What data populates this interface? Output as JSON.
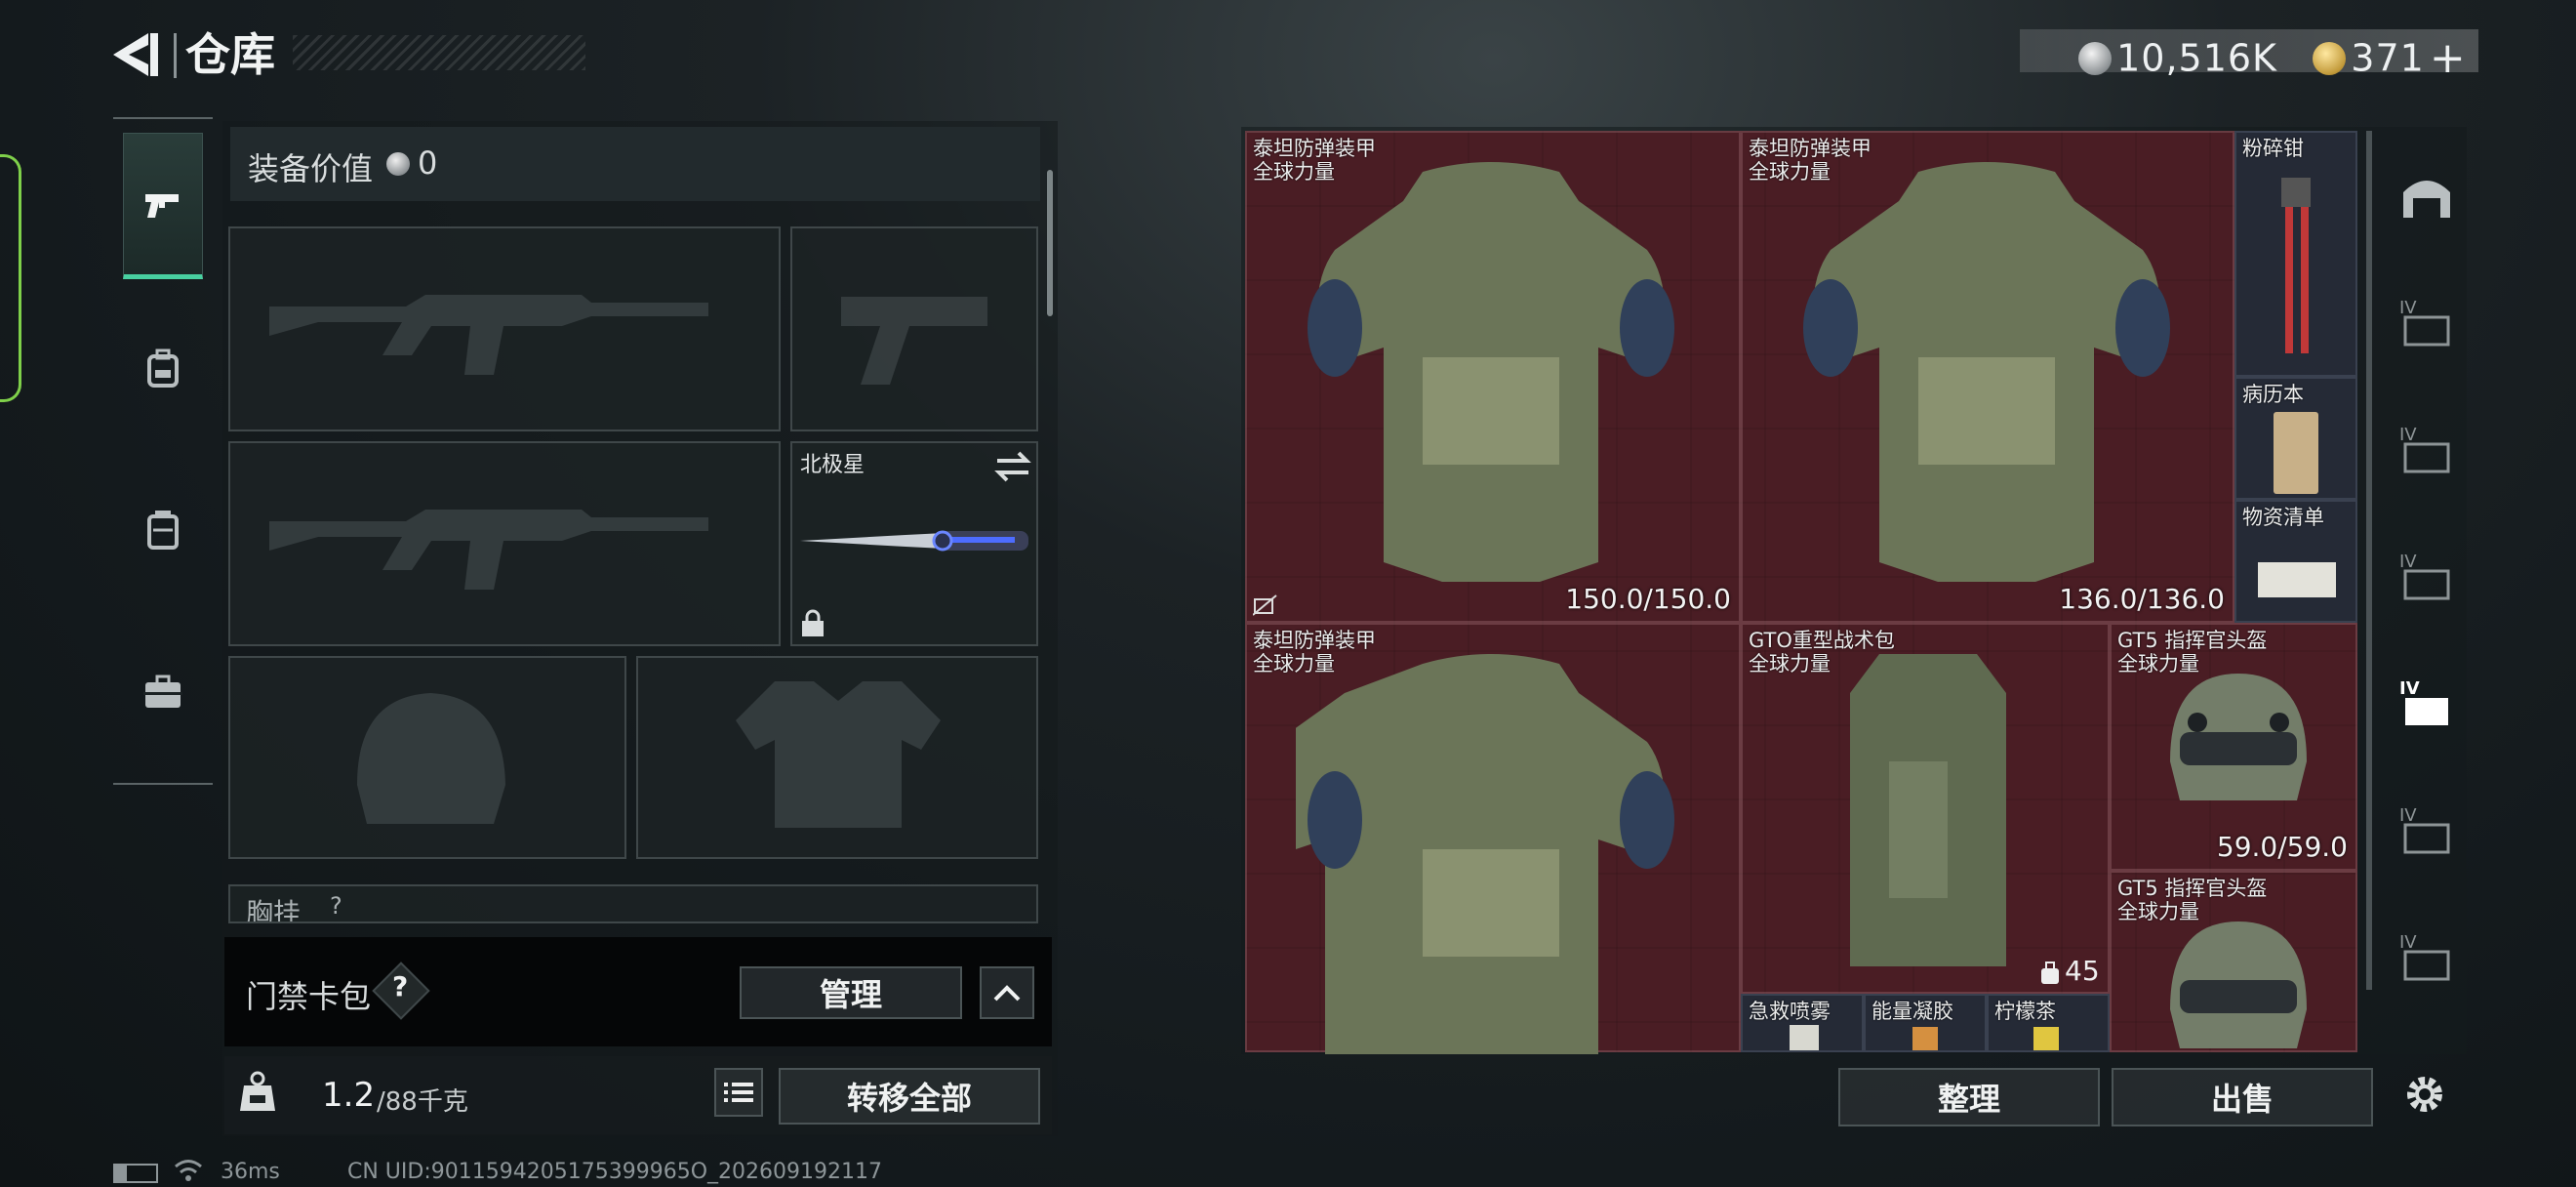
{
  "header": {
    "title": "仓库",
    "silver_amount": "10,516K",
    "gold_amount": "371",
    "gold_plus": "+"
  },
  "left": {
    "value_label": "装备价值",
    "value_amount": "0",
    "pistol_slot_label": "北极星",
    "partial_label": "胸挂",
    "partial_help": "?",
    "access_label": "门禁卡包",
    "access_help": "?",
    "manage_button": "管理",
    "weight_value": "1.2",
    "weight_max": "/88千克",
    "transfer_button": "转移全部"
  },
  "grid_items": [
    {
      "name": "泰坦防弹装甲",
      "sub": "全球力量",
      "durability": "150.0/150.0"
    },
    {
      "name": "泰坦防弹装甲",
      "sub": "全球力量",
      "durability": "136.0/136.0"
    },
    {
      "name": "粉碎钳"
    },
    {
      "name": "病历本"
    },
    {
      "name": "物资清单"
    },
    {
      "name": "泰坦防弹装甲",
      "sub": "全球力量"
    },
    {
      "name": "GTO重型战术包",
      "sub": "全球力量",
      "count": "45"
    },
    {
      "name": "GT5 指挥官头盔",
      "sub": "全球力量",
      "durability": "59.0/59.0"
    },
    {
      "name": "GT5 指挥官头盔",
      "sub": "全球力量"
    },
    {
      "name": "急救喷雾"
    },
    {
      "name": "能量凝胶"
    },
    {
      "name": "柠檬茶"
    }
  ],
  "right_buttons": {
    "sort": "整理",
    "sell": "出售"
  },
  "status": {
    "ping": "36ms",
    "uid": "CN UID:9011594205175399965O_202609192117"
  },
  "colors": {
    "accent_green": "#48d0a0",
    "grid_red": "#4a1e24",
    "highlight_green": "#7fd04a"
  }
}
